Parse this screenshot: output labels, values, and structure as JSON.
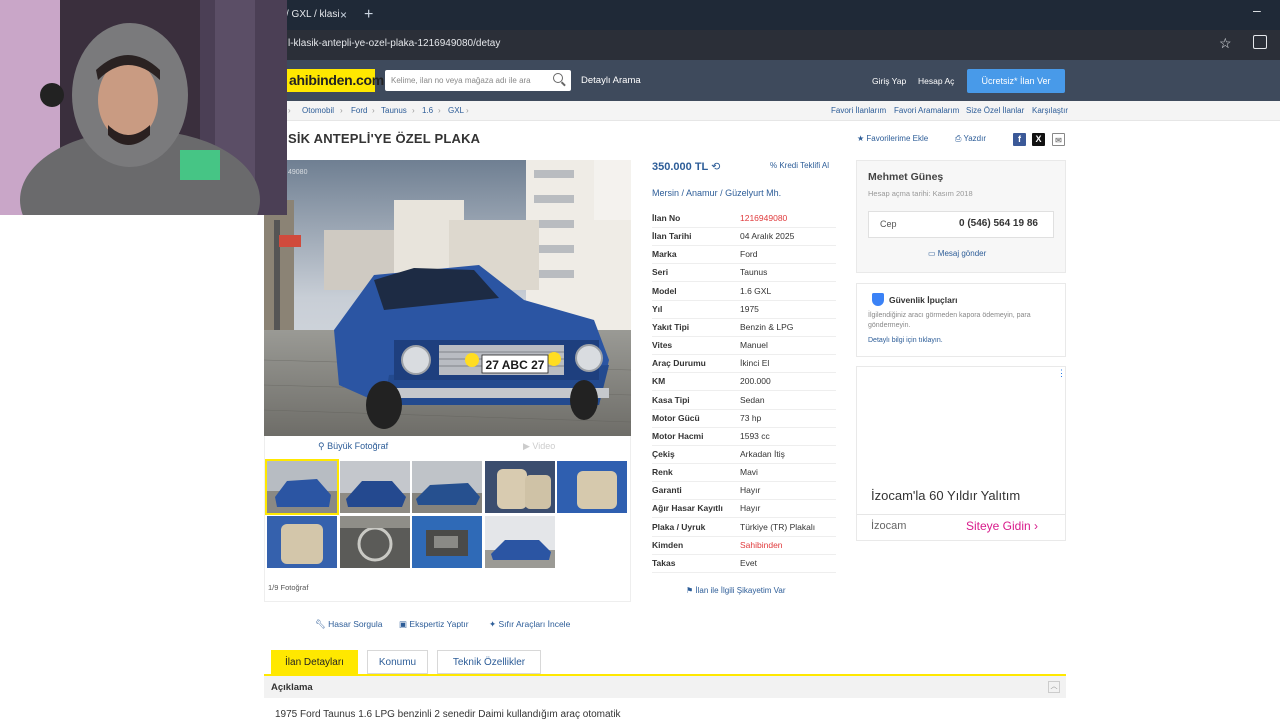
{
  "browser": {
    "tab_title": "/ GXL / klasi",
    "tab_close": "×",
    "new_tab": "+",
    "minimize": "–",
    "url": "l-klasik-antepli-ye-ozel-plaka-1216949080/detay",
    "bookmark_icon": "star-icon"
  },
  "header": {
    "logo": "ahibinden.com",
    "search_placeholder": "Kelime, ilan no veya mağaza adı ile ara",
    "detailed_search": "Detaylı Arama",
    "login": "Giriş Yap",
    "register": "Hesap Aç",
    "post_ad": "Ücretsiz* İlan Ver"
  },
  "breadcrumb": [
    "Otomobil",
    "Ford",
    "Taunus",
    "1.6",
    "GXL"
  ],
  "favorites_links": [
    "Favori İlanlarım",
    "Favori Aramalarım",
    "Size Özel İlanlar",
    "Karşılaştır"
  ],
  "listing": {
    "title": "SİK ANTEPLİ'YE ÖZEL PLAKA",
    "add_favorite": "Favorilerime Ekle",
    "print": "Yazdır",
    "photo_watermark": "49080",
    "big_photo": "Büyük Fotoğraf",
    "video": "Video",
    "photo_count": "1/9 Fotoğraf",
    "price": "350.000 TL",
    "credit_offer": "Kredi Teklifi Al",
    "location": [
      "Mersin",
      "Anamur",
      "Güzelyurt Mh."
    ],
    "details": [
      {
        "label": "İlan No",
        "value": "1216949080",
        "highlight": true
      },
      {
        "label": "İlan Tarihi",
        "value": "04 Aralık 2025"
      },
      {
        "label": "Marka",
        "value": "Ford"
      },
      {
        "label": "Seri",
        "value": "Taunus"
      },
      {
        "label": "Model",
        "value": "1.6 GXL"
      },
      {
        "label": "Yıl",
        "value": "1975"
      },
      {
        "label": "Yakıt Tipi",
        "value": "Benzin & LPG"
      },
      {
        "label": "Vites",
        "value": "Manuel"
      },
      {
        "label": "Araç Durumu",
        "value": "İkinci El"
      },
      {
        "label": "KM",
        "value": "200.000"
      },
      {
        "label": "Kasa Tipi",
        "value": "Sedan"
      },
      {
        "label": "Motor Gücü",
        "value": "73 hp"
      },
      {
        "label": "Motor Hacmi",
        "value": "1593 cc"
      },
      {
        "label": "Çekiş",
        "value": "Arkadan İtiş"
      },
      {
        "label": "Renk",
        "value": "Mavi"
      },
      {
        "label": "Garanti",
        "value": "Hayır"
      },
      {
        "label": "Ağır Hasar Kayıtlı",
        "value": "Hayır"
      },
      {
        "label": "Plaka / Uyruk",
        "value": "Türkiye (TR) Plakalı"
      },
      {
        "label": "Kimden",
        "value": "Sahibinden",
        "highlight": true
      },
      {
        "label": "Takas",
        "value": "Evet"
      }
    ],
    "complaint": "İlan ile İlgili Şikayetim Var",
    "license_plate": "27 ABC 27"
  },
  "seller": {
    "name": "Mehmet Güneş",
    "joined": "Hesap açma tarihi: Kasım 2018",
    "phone_label": "Cep",
    "phone": "0 (546) 564 19 86",
    "message": "Mesaj gönder"
  },
  "safety": {
    "title": "Güvenlik İpuçları",
    "text": "İlgilendiğiniz aracı görmeden kapora ödemeyin, para göndermeyin.",
    "link": "Detaylı bilgi için tıklayın."
  },
  "ad": {
    "menu": "⋮",
    "headline": "İzocam'la 60 Yıldır Yalıtım",
    "brand": "İzocam",
    "cta": "Siteye Gidin"
  },
  "tools": [
    "Hasar Sorgula",
    "Ekspertiz Yaptır",
    "Sıfır Araçları İncele"
  ],
  "tabs": [
    "İlan Detayları",
    "Konumu",
    "Teknik Özellikler"
  ],
  "description": {
    "header": "Açıklama",
    "text": "1975 Ford Taunus 1.6 LPG benzinli 2 senedir Daimi kullandığım araç otomatik"
  },
  "colors": {
    "brand_yellow": "#ffe800",
    "header_bg": "#3e4a5c",
    "link_blue": "#2d5d98",
    "cta_blue": "#489ae9",
    "highlight_red": "#e03a3c",
    "car_blue": "#2b55a3"
  }
}
